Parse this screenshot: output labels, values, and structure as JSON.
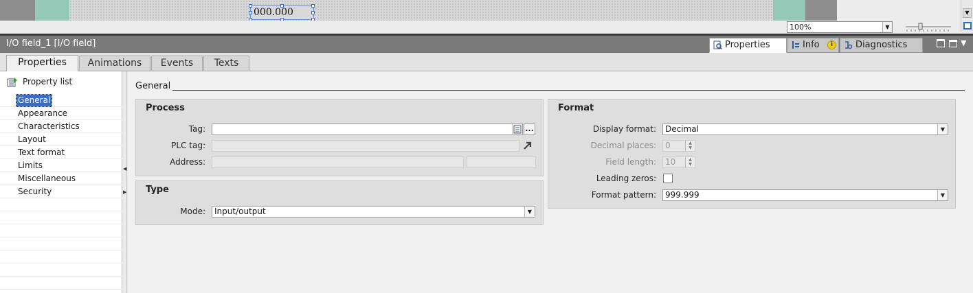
{
  "canvas": {
    "io_field_value": "000.000"
  },
  "statusbar": {
    "zoom": "100%"
  },
  "inspector": {
    "title": "I/O field_1 [I/O field]",
    "view_tabs": [
      {
        "label": "Properties"
      },
      {
        "label": "Info"
      },
      {
        "label": "Diagnostics"
      }
    ],
    "tabs": [
      {
        "label": "Properties"
      },
      {
        "label": "Animations"
      },
      {
        "label": "Events"
      },
      {
        "label": "Texts"
      }
    ]
  },
  "nav": {
    "property_list": "Property list",
    "items": [
      {
        "label": "General"
      },
      {
        "label": "Appearance"
      },
      {
        "label": "Characteristics"
      },
      {
        "label": "Layout"
      },
      {
        "label": "Text format"
      },
      {
        "label": "Limits"
      },
      {
        "label": "Miscellaneous"
      },
      {
        "label": "Security"
      }
    ]
  },
  "main": {
    "section_title": "General",
    "process": {
      "title": "Process",
      "tag_label": "Tag:",
      "tag_value": "",
      "plc_tag_label": "PLC tag:",
      "address_label": "Address:"
    },
    "type": {
      "title": "Type",
      "mode_label": "Mode:",
      "mode_value": "Input/output"
    },
    "format": {
      "title": "Format",
      "display_format_label": "Display format:",
      "display_format_value": "Decimal",
      "decimal_places_label": "Decimal places:",
      "decimal_places_value": "0",
      "field_length_label": "Field length:",
      "field_length_value": "10",
      "leading_zeros_label": "Leading zeros:",
      "leading_zeros_checked": false,
      "format_pattern_label": "Format pattern:",
      "format_pattern_value": "999.999"
    }
  },
  "colors": {
    "selection": "#3a6fc0",
    "canvas_accent": "#94c9b8",
    "titlebar": "#7a7a7a"
  },
  "icons": [
    "property-list-icon",
    "properties-icon",
    "info-icon",
    "warning-icon",
    "diagnostics-icon",
    "tag-list-icon",
    "ellipsis-icon",
    "goto-arrow-icon",
    "chevron-down-icon"
  ]
}
